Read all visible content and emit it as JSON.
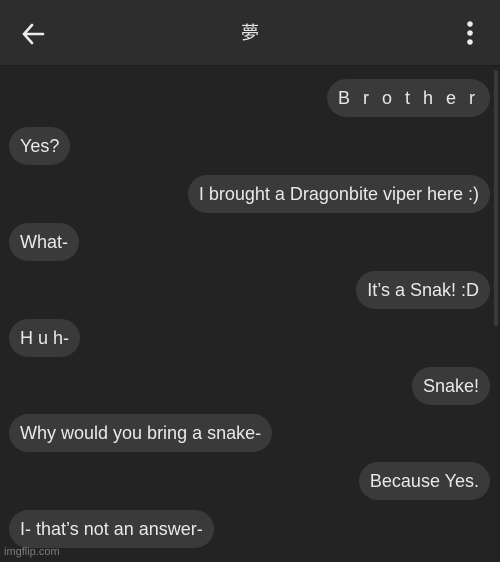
{
  "header": {
    "title": "夢",
    "back_icon": "arrow-left-icon",
    "menu_icon": "more-vertical-icon"
  },
  "messages": [
    {
      "direction": "outgoing",
      "text": "B r o t h e r"
    },
    {
      "direction": "incoming",
      "text": "Yes?"
    },
    {
      "direction": "outgoing",
      "text": "I brought a Dragonbite viper here :)"
    },
    {
      "direction": "incoming",
      "text": "What-"
    },
    {
      "direction": "outgoing",
      "text": "It’s a Snak! :D"
    },
    {
      "direction": "incoming",
      "text": "H u h-"
    },
    {
      "direction": "outgoing",
      "text": "Snake!"
    },
    {
      "direction": "incoming",
      "text": "Why would you bring a snake-"
    },
    {
      "direction": "outgoing",
      "text": "Because Yes."
    },
    {
      "direction": "incoming",
      "text": "I- that’s not an answer-"
    }
  ],
  "watermark": "imgflip.com",
  "colors": {
    "background": "#232323",
    "header": "#2d2d2d",
    "bubble": "#3a3a3a",
    "text": "#e9e9e9"
  }
}
